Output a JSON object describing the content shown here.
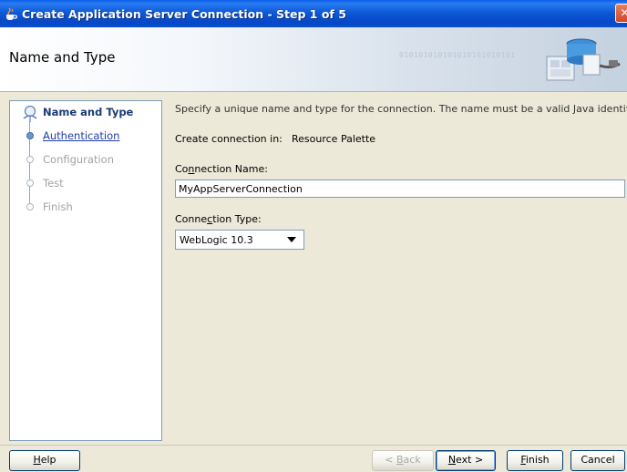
{
  "window": {
    "title": "Create Application Server Connection - Step 1 of 5",
    "close_glyph": "✕"
  },
  "header": {
    "title": "Name and Type",
    "binary_text": "010101010101010101010101"
  },
  "steps": [
    {
      "label": "Name and Type",
      "state": "current"
    },
    {
      "label": "Authentication",
      "state": "link"
    },
    {
      "label": "Configuration",
      "state": "disabled"
    },
    {
      "label": "Test",
      "state": "disabled"
    },
    {
      "label": "Finish",
      "state": "disabled"
    }
  ],
  "main": {
    "instructions": "Specify a unique name and type for the connection. The name must be a valid Java identifier.",
    "create_in_label": "Create connection in:",
    "create_in_value": "Resource Palette",
    "name_label_pre": "Co",
    "name_label_mnemonic": "n",
    "name_label_post": "nection Name:",
    "name_value": "MyAppServerConnection",
    "type_label_pre": "Conne",
    "type_label_mnemonic": "c",
    "type_label_post": "tion Type:",
    "type_value": "WebLogic 10.3"
  },
  "footer": {
    "help": {
      "mnemonic": "H",
      "rest": "elp"
    },
    "back": {
      "prefix": "< ",
      "mnemonic": "B",
      "rest": "ack"
    },
    "next": {
      "mnemonic": "N",
      "rest": "ext >"
    },
    "finish": {
      "mnemonic": "F",
      "rest": "inish"
    },
    "cancel": "Cancel"
  },
  "colors": {
    "titlebar": "#0a5ee8",
    "current_step": "#1a3b78",
    "link_step": "#1f3ea8",
    "disabled_step": "#a3a3a3"
  }
}
